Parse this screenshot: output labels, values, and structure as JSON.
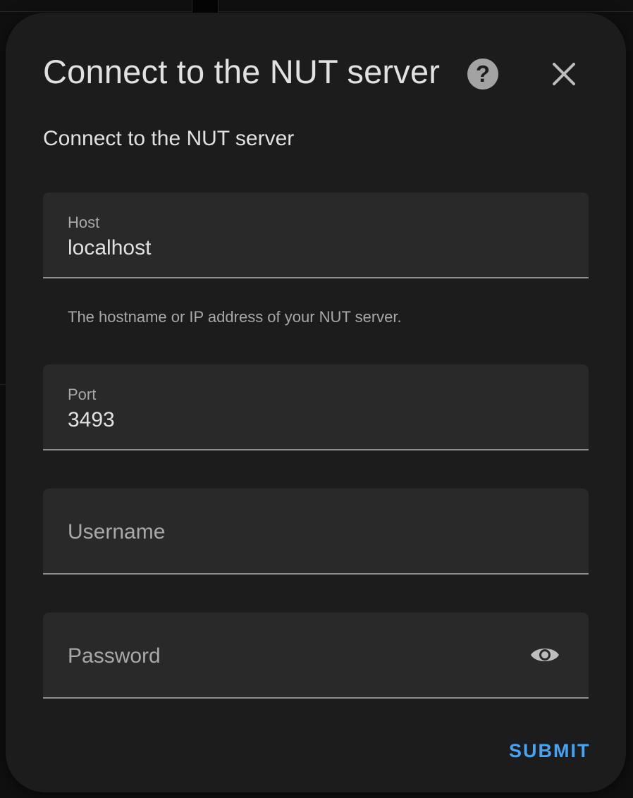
{
  "dialog": {
    "title": "Connect to the NUT server",
    "subtitle": "Connect to the NUT server",
    "help_icon": "help-circle-icon",
    "close_icon": "close-icon"
  },
  "form": {
    "host": {
      "label": "Host",
      "value": "localhost",
      "helper": "The hostname or IP address of your NUT server."
    },
    "port": {
      "label": "Port",
      "value": "3493"
    },
    "username": {
      "placeholder": "Username"
    },
    "password": {
      "placeholder": "Password",
      "toggle_icon": "eye-icon"
    }
  },
  "actions": {
    "submit_label": "SUBMIT"
  },
  "colors": {
    "accent": "#47a3f3",
    "dialog_bg": "#1c1c1c",
    "field_bg": "#292929"
  }
}
